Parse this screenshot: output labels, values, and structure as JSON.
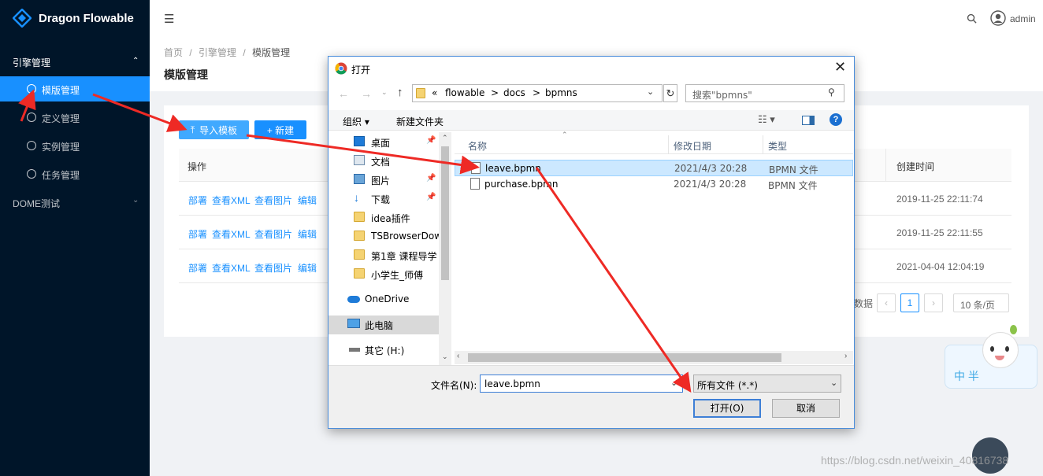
{
  "app": {
    "brand": "Dragon Flowable",
    "user": "admin"
  },
  "sidebar": {
    "group1": "引擎管理",
    "items": [
      {
        "label": "模版管理"
      },
      {
        "label": "定义管理"
      },
      {
        "label": "实例管理"
      },
      {
        "label": "任务管理"
      }
    ],
    "group2": "DOME测试"
  },
  "breadcrumb": [
    "首页",
    "/",
    "引擎管理",
    "/",
    "模版管理"
  ],
  "page_title": "模版管理",
  "toolbar": {
    "import_label": "导入模板",
    "new_label": "+ 新建"
  },
  "table": {
    "headers": {
      "action": "操作",
      "created": "创建时间"
    },
    "rows": [
      {
        "actions": [
          "部署",
          "查看XML",
          "查看图片",
          "编辑"
        ],
        "created": "2019-11-25 22:11:74"
      },
      {
        "actions": [
          "部署",
          "查看XML",
          "查看图片",
          "编辑"
        ],
        "created": "2019-11-25 22:11:55"
      },
      {
        "actions": [
          "部署",
          "查看XML",
          "查看图片",
          "编辑"
        ],
        "created": "2021-04-04 12:04:19"
      }
    ],
    "pagination": {
      "total_suffix": "数据",
      "current_page": "1",
      "page_size": "10 条/页"
    }
  },
  "dialog": {
    "title": "打开",
    "path": [
      "«",
      "flowable",
      ">",
      "docs",
      ">",
      "bpmns"
    ],
    "search_placeholder": "搜索\"bpmns\"",
    "organize": "组织 ▾",
    "new_folder": "新建文件夹",
    "tree": [
      "桌面",
      "文档",
      "图片",
      "下载",
      "idea插件",
      "TSBrowserDow",
      "第1章 课程导学",
      "小学生_师傅",
      "OneDrive",
      "此电脑",
      "其它 (H:)"
    ],
    "columns": {
      "name": "名称",
      "date": "修改日期",
      "type": "类型"
    },
    "files": [
      {
        "name": "leave.bpmn",
        "date": "2021/4/3 20:28",
        "type": "BPMN 文件"
      },
      {
        "name": "purchase.bpmn",
        "date": "2021/4/3 20:28",
        "type": "BPMN 文件"
      }
    ],
    "filename_label": "文件名(N):",
    "filename_value": "leave.bpmn",
    "filter_value": "所有文件 (*.*)",
    "open_label": "打开(O)",
    "cancel_label": "取消"
  },
  "sticker_text": "中 半",
  "watermark": "https://blog.csdn.net/weixin_40816738",
  "colors": {
    "sidebar_bg": "#001529",
    "primary": "#1890ff",
    "arrow": "#ee2a25",
    "dialog_select": "#cce8ff"
  }
}
